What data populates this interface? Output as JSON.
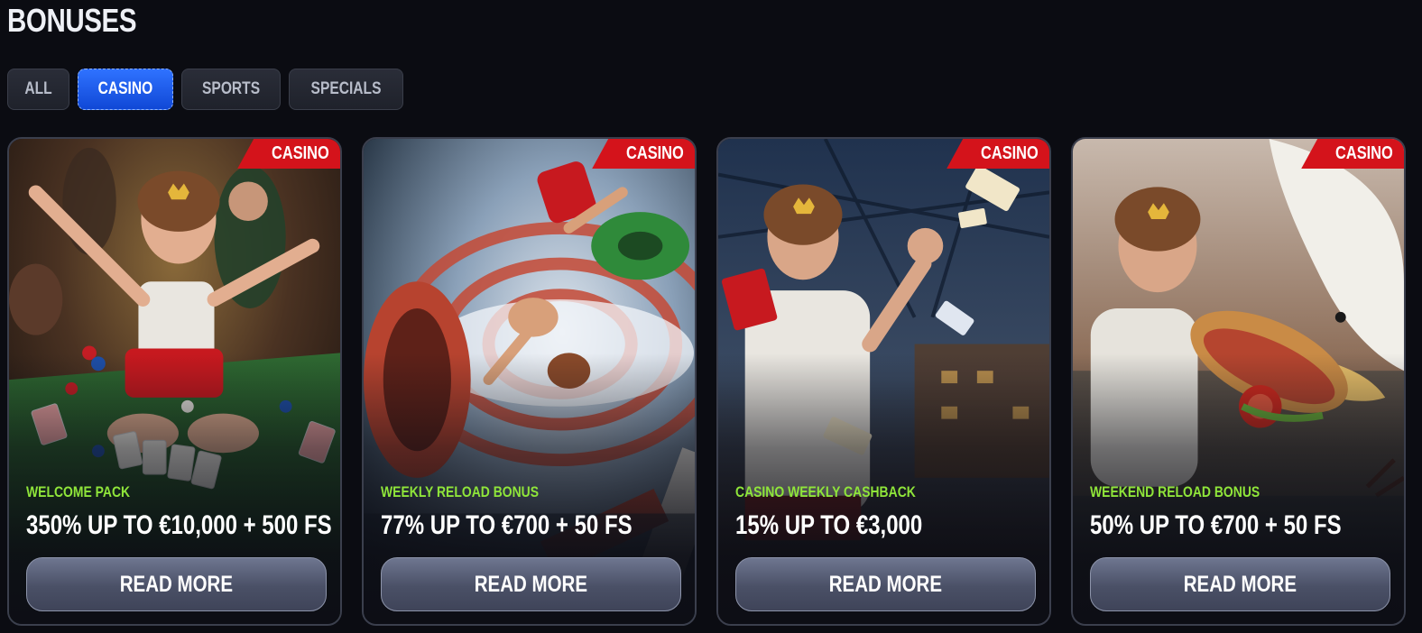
{
  "page": {
    "title": "BONUSES"
  },
  "filters": [
    {
      "label": "ALL",
      "active": false
    },
    {
      "label": "CASINO",
      "active": true
    },
    {
      "label": "SPORTS",
      "active": false
    },
    {
      "label": "SPECIALS",
      "active": false
    }
  ],
  "cards": [
    {
      "badge": "CASINO",
      "label": "WELCOME PACK",
      "offer": "350% UP TO €10,000 + 500 FS",
      "button": "READ MORE",
      "image": "casino-table-celebration-illustration"
    },
    {
      "badge": "CASINO",
      "label": "WEEKLY RELOAD BONUS",
      "offer": "77% UP TO €700 + 50 FS",
      "button": "READ MORE",
      "image": "water-slide-illustration"
    },
    {
      "badge": "CASINO",
      "label": "CASINO WEEKLY CASHBACK",
      "offer": "15% UP TO €3,000",
      "button": "READ MORE",
      "image": "coupons-flying-illustration"
    },
    {
      "badge": "CASINO",
      "label": "WEEKEND RELOAD BONUS",
      "offer": "50% UP TO €700 + 50 FS",
      "button": "READ MORE",
      "image": "seagull-sandwich-illustration"
    }
  ],
  "colors": {
    "background": "#0b0c12",
    "accent_active": "#1f5cf0",
    "badge": "#d4131b",
    "label_green": "#8fe53a"
  }
}
